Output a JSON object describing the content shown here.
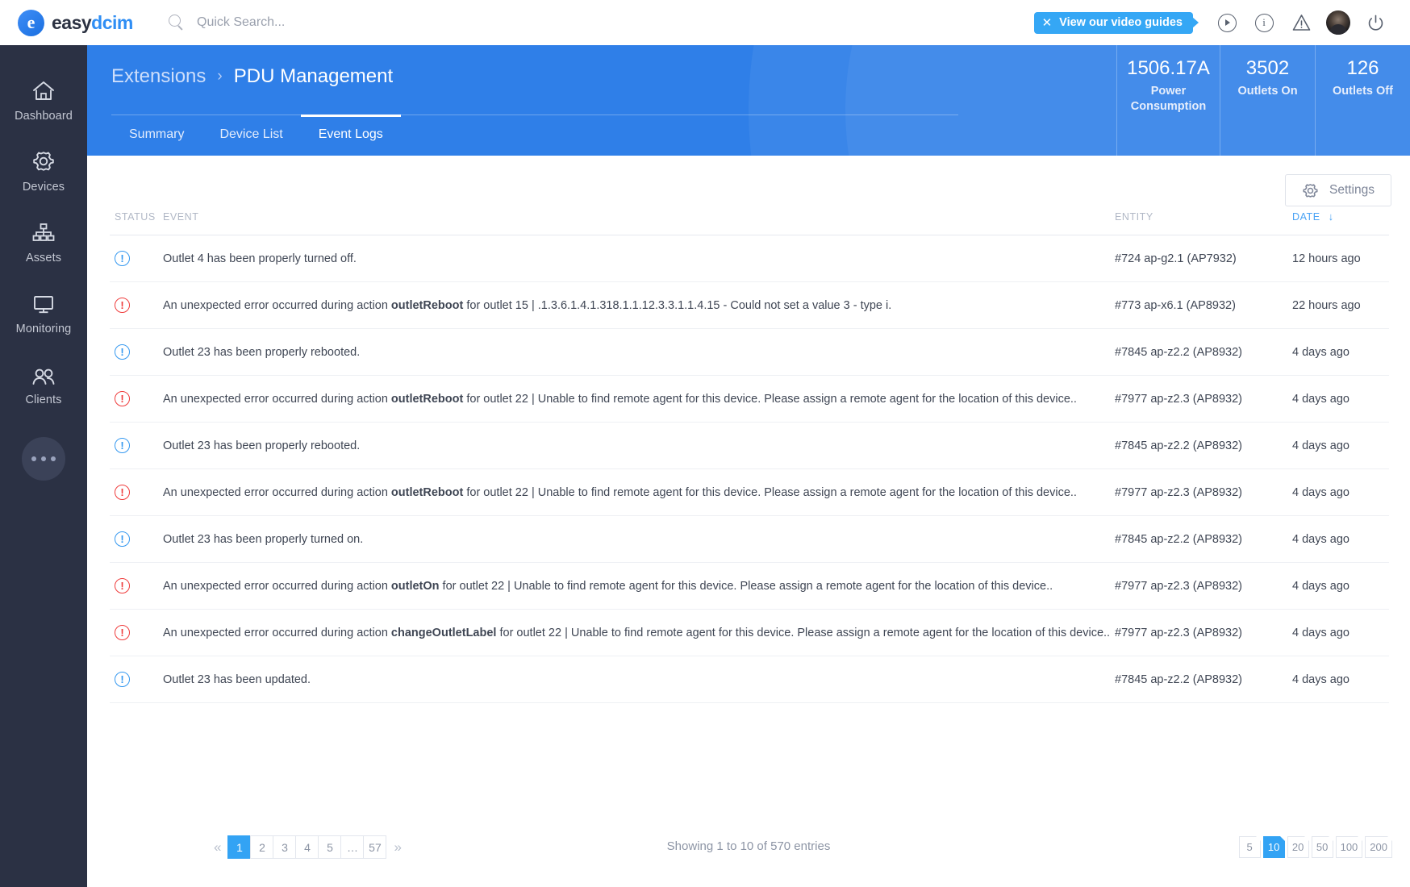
{
  "brand": {
    "logo_primary": "easy",
    "logo_secondary": "dcim",
    "logo_glyph": "e"
  },
  "search": {
    "placeholder": "Quick Search...",
    "value": ""
  },
  "topbar": {
    "video_badge": "View our video guides",
    "close_label": "✕",
    "info_label": "i"
  },
  "sidebar": {
    "items": [
      {
        "label": "Dashboard",
        "icon": "home-icon"
      },
      {
        "label": "Devices",
        "icon": "gear-icon"
      },
      {
        "label": "Assets",
        "icon": "sitemap-icon"
      },
      {
        "label": "Monitoring",
        "icon": "monitor-icon"
      },
      {
        "label": "Clients",
        "icon": "people-icon"
      }
    ],
    "more_label": "more-icon"
  },
  "header": {
    "breadcrumb_parent": "Extensions",
    "breadcrumb_sep": "›",
    "breadcrumb_current": "PDU Management",
    "tabs": [
      {
        "label": "Summary",
        "active": false
      },
      {
        "label": "Device List",
        "active": false
      },
      {
        "label": "Event Logs",
        "active": true
      }
    ],
    "stats": [
      {
        "value": "1506.17A",
        "label": "Power Consumption"
      },
      {
        "value": "3502",
        "label": "Outlets On"
      },
      {
        "value": "126",
        "label": "Outlets Off"
      }
    ]
  },
  "toolbar": {
    "settings_label": "Settings"
  },
  "table": {
    "columns": {
      "status": "STATUS",
      "event": "EVENT",
      "entity": "ENTITY",
      "date": "DATE",
      "sort_arrow": "↓"
    },
    "rows": [
      {
        "status": "info",
        "icon_char": "!",
        "event_prefix": "Outlet 4 has been properly turned off.",
        "action": "",
        "event_suffix": "",
        "entity": "#724 ap-g2.1 (AP7932)",
        "date": "12 hours ago"
      },
      {
        "status": "error",
        "icon_char": "!",
        "event_prefix": "An unexpected error occurred during action ",
        "action": "outletReboot",
        "event_suffix": " for outlet 15 | .1.3.6.1.4.1.318.1.1.12.3.3.1.1.4.15 - Could not set a value 3 - type i.",
        "entity": "#773 ap-x6.1 (AP8932)",
        "date": "22 hours ago"
      },
      {
        "status": "info",
        "icon_char": "!",
        "event_prefix": "Outlet 23 has been properly rebooted.",
        "action": "",
        "event_suffix": "",
        "entity": "#7845 ap-z2.2 (AP8932)",
        "date": "4 days ago"
      },
      {
        "status": "error",
        "icon_char": "!",
        "event_prefix": "An unexpected error occurred during action ",
        "action": "outletReboot",
        "event_suffix": " for outlet 22 | Unable to find remote agent for this device. Please assign a remote agent for the location of this device..",
        "entity": "#7977 ap-z2.3 (AP8932)",
        "date": "4 days ago"
      },
      {
        "status": "info",
        "icon_char": "!",
        "event_prefix": "Outlet 23 has been properly rebooted.",
        "action": "",
        "event_suffix": "",
        "entity": "#7845 ap-z2.2 (AP8932)",
        "date": "4 days ago"
      },
      {
        "status": "error",
        "icon_char": "!",
        "event_prefix": "An unexpected error occurred during action ",
        "action": "outletReboot",
        "event_suffix": " for outlet 22 | Unable to find remote agent for this device. Please assign a remote agent for the location of this device..",
        "entity": "#7977 ap-z2.3 (AP8932)",
        "date": "4 days ago"
      },
      {
        "status": "info",
        "icon_char": "!",
        "event_prefix": "Outlet 23 has been properly turned on.",
        "action": "",
        "event_suffix": "",
        "entity": "#7845 ap-z2.2 (AP8932)",
        "date": "4 days ago"
      },
      {
        "status": "error",
        "icon_char": "!",
        "event_prefix": "An unexpected error occurred during action ",
        "action": "outletOn",
        "event_suffix": " for outlet 22 | Unable to find remote agent for this device. Please assign a remote agent for the location of this device..",
        "entity": "#7977 ap-z2.3 (AP8932)",
        "date": "4 days ago"
      },
      {
        "status": "error",
        "icon_char": "!",
        "event_prefix": "An unexpected error occurred during action ",
        "action": "changeOutletLabel",
        "event_suffix": " for outlet 22 | Unable to find remote agent for this device. Please assign a remote agent for the location of this device..",
        "entity": "#7977 ap-z2.3 (AP8932)",
        "date": "4 days ago"
      },
      {
        "status": "info",
        "icon_char": "!",
        "event_prefix": "Outlet 23 has been updated.",
        "action": "",
        "event_suffix": "",
        "entity": "#7845 ap-z2.2 (AP8932)",
        "date": "4 days ago"
      }
    ]
  },
  "footer": {
    "prev_label": "«",
    "next_label": "»",
    "pages": [
      "1",
      "2",
      "3",
      "4",
      "5",
      "…",
      "57"
    ],
    "active_page": "1",
    "showing": "Showing 1 to 10 of 570 entries",
    "page_sizes": [
      "5",
      "10",
      "20",
      "50",
      "100",
      "200"
    ],
    "active_size": "10"
  },
  "colors": {
    "accent_blue": "#33a3f4",
    "header_blue": "#2f7fe8",
    "sidebar_navy": "#2b3144",
    "error_red": "#ef3b3b",
    "info_blue": "#3498f0"
  }
}
